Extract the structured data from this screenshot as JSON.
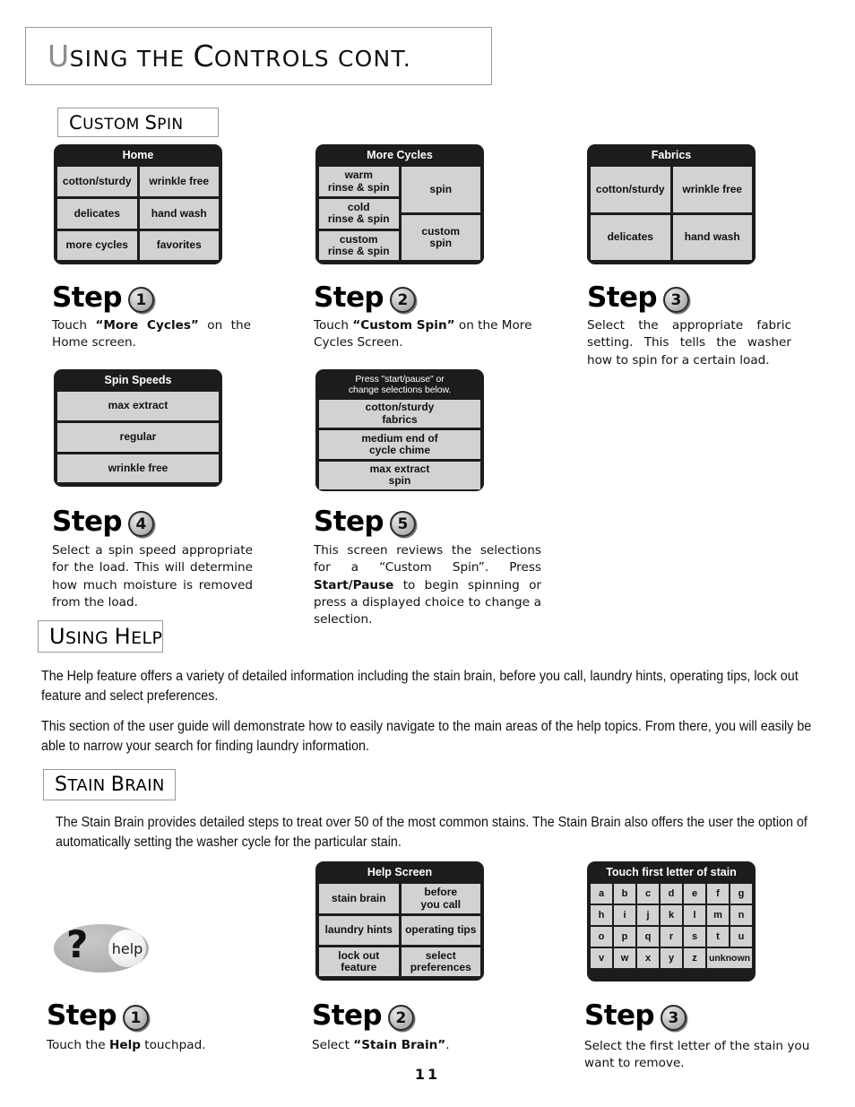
{
  "page": {
    "title": "Using the Controls cont.",
    "number": "11"
  },
  "sections": {
    "custom_spin": "Custom Spin",
    "using_help": "Using Help",
    "stain_brain": "Stain Brain"
  },
  "panels": {
    "home": {
      "header": "Home",
      "left": [
        "cotton/sturdy",
        "delicates",
        "more cycles"
      ],
      "right": [
        "wrinkle free",
        "hand wash",
        "favorites"
      ]
    },
    "more_cycles": {
      "header": "More Cycles",
      "left": [
        "warm\nrinse & spin",
        "cold\nrinse & spin",
        "custom\nrinse & spin"
      ],
      "right": [
        "spin",
        "custom\nspin"
      ]
    },
    "fabrics": {
      "header": "Fabrics",
      "left": [
        "cotton/sturdy",
        "delicates"
      ],
      "right": [
        "wrinkle free",
        "hand wash"
      ]
    },
    "spin_speeds": {
      "header": "Spin Speeds",
      "rows": [
        "max extract",
        "regular",
        "wrinkle free"
      ]
    },
    "review": {
      "header": "Press \"start/pause\" or\nchange selections below.",
      "rows": [
        "cotton/sturdy\nfabrics",
        "medium end of\ncycle chime",
        "max extract\nspin"
      ]
    },
    "help_screen": {
      "header": "Help Screen",
      "left": [
        "stain brain",
        "laundry hints",
        "lock out\nfeature"
      ],
      "right": [
        "before\nyou call",
        "operating tips",
        "select\npreferences"
      ]
    },
    "letters": {
      "header": "Touch first letter of stain",
      "keys": [
        "a",
        "b",
        "c",
        "d",
        "e",
        "f",
        "g",
        "h",
        "i",
        "j",
        "k",
        "l",
        "m",
        "n",
        "o",
        "p",
        "q",
        "r",
        "s",
        "t",
        "u",
        "v",
        "w",
        "x",
        "y",
        "z"
      ],
      "unknown_key": "unknown"
    }
  },
  "steps": {
    "custom_spin": [
      {
        "word": "Step",
        "num": "1",
        "text_html": "Touch <b>&ldquo;More Cycles&rdquo;</b> on the Home screen."
      },
      {
        "word": "Step",
        "num": "2",
        "text_html": "Touch <b>&ldquo;Custom Spin&rdquo;</b> on the More Cycles Screen."
      },
      {
        "word": "Step",
        "num": "3",
        "text_html": "Select the appropriate fabric setting. This tells the washer how to spin for a certain load."
      },
      {
        "word": "Step",
        "num": "4",
        "text_html": "Select a spin speed appropriate for the load.  This will determine how much moisture is removed from the load."
      },
      {
        "word": "Step",
        "num": "5",
        "text_html": "This screen reviews the selections for a &ldquo;Custom Spin&rdquo;.  Press <b>Start/Pause</b> to begin spinning or press a displayed choice to change a selection."
      }
    ],
    "help": [
      {
        "word": "Step",
        "num": "1",
        "text_html": "Touch the <b>Help</b> touchpad."
      },
      {
        "word": "Step",
        "num": "2",
        "text_html": "Select <b>&ldquo;Stain Brain&rdquo;</b>."
      },
      {
        "word": "Step",
        "num": "3",
        "text_html": "Select the first letter of the stain you want to remove."
      }
    ]
  },
  "paragraphs": {
    "help_intro_1": "The Help feature offers a variety of detailed information including the stain brain, before you call, laundry hints, operating tips, lock out feature and select preferences.",
    "help_intro_2": "This section of the user guide will demonstrate how to easily navigate to the main areas of the help topics.  From there, you will easily be able to narrow your search for finding laundry information.",
    "stain_brain_body": "The Stain Brain provides detailed steps to treat over 50 of the most common stains.  The Stain Brain also offers the user the option of automatically setting the washer cycle for the particular stain."
  },
  "help_pad": {
    "question_mark": "?",
    "label": "help"
  }
}
